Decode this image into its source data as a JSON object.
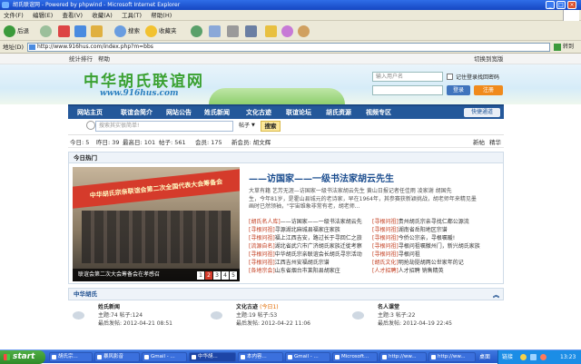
{
  "window": {
    "title": "胡氏联谊网 - Powered by phpwind - Microsoft Internet Explorer"
  },
  "menu": [
    "文件(F)",
    "编辑(E)",
    "查看(V)",
    "收藏(A)",
    "工具(T)",
    "帮助(H)"
  ],
  "toolbar": {
    "back": "后退",
    "search": "搜索",
    "favorites": "收藏夹"
  },
  "address": {
    "label": "地址(D)",
    "url": "http://www.916hus.com/index.php?m=bbs",
    "go": "转到"
  },
  "site": {
    "topbar_left": [
      "统计排行",
      "帮助"
    ],
    "topbar_right": "切换到宽版",
    "logo_title": "中华胡氏联谊网",
    "logo_url": "www.916hus.com",
    "login": {
      "user_placeholder": "输入用户名",
      "remember": "记住登录",
      "forgot": "找回密码",
      "login_btn": "登录",
      "register_btn": "注册"
    },
    "nav": [
      "网站主页",
      "联谊会简介",
      "网站公告",
      "姓氏新闻",
      "文化古迹",
      "联谊论坛",
      "胡氏资源",
      "视频专区"
    ],
    "quick": "快捷通道",
    "search": {
      "placeholder": "搜索其实很简单!",
      "scope": "帖子",
      "button": "搜索"
    },
    "stats": {
      "today": "今日: 5",
      "yesterday": "昨日: 39",
      "max": "最高日: 101",
      "posts": "帖子: 561",
      "members": "会员: 175",
      "new_member": "新会员: 胡文辉"
    },
    "stats_right": [
      "新帖",
      "精华"
    ],
    "hot_title": "今日热门",
    "banner_text": "中华胡氏宗亲联谊会第二次全国代表大会筹备会",
    "slide_caption": "联谊会第二次大会筹备会在孝感召",
    "slide_nums": [
      "1",
      "2",
      "3",
      "4",
      "5"
    ],
    "headline": "——访国家——一级书法家胡云先生",
    "summary": [
      "大草有籍    艺芳无涯—访国家一级书法家胡云先生  黄山日报记者任佳雨  凌家谢    胡国先",
      "生，今年81岁，是霍山县城元的老诗家，早在1964年，其参赛获新颖挑战，胡老师年来精见墨",
      "画时已然领袖，\"宇宙维象非常有老，胡老师..."
    ],
    "news_left": [
      {
        "tag": "[胡氏名人库]",
        "title": "——访国家——一级书法家胡云先"
      },
      {
        "tag": "[寻根问祖]",
        "title": "寻源湖北麻城县福家庄家族"
      },
      {
        "tag": "[寻根问祖]",
        "title": "福上江西吉安，路过长于寻回仁之旅"
      },
      {
        "tag": "[流源自名]",
        "title": "湖北省武穴市广济胡氏家族迁徙考察"
      },
      {
        "tag": "[寻根问祖]",
        "title": "中华胡氏宗亲联谊会长胡氏寻宗活动"
      },
      {
        "tag": "[寻根问祖]",
        "title": "江西吉州安福胡氏宗谱"
      },
      {
        "tag": "[各地宗会]",
        "title": "山东省烟台市莱阳县胡家庄"
      }
    ],
    "news_right": [
      {
        "tag": "[寻根问祖]",
        "title": "贵州胡氏宗亲寻找仁都公源流"
      },
      {
        "tag": "[寻根问祖]",
        "title": "湖南省岳阳地区宗谱"
      },
      {
        "tag": "[寻根问祖]",
        "title": "今侨公宗亲，寻根嘱暖!"
      },
      {
        "tag": "[寻根问祖]",
        "title": "寻根问祖嘱徽州门，新兴胡氏家族"
      },
      {
        "tag": "[寻根问祖]",
        "title": "寻根问祖"
      },
      {
        "tag": "[胡氏文化]",
        "title": "明抢劫挺胡两公世家年的记"
      },
      {
        "tag": "[人才招聘]",
        "title": "人才招聘 销售精英"
      }
    ],
    "zone": "中华胡氏",
    "forums": [
      {
        "name": "姓氏新闻",
        "today": "",
        "stats": "主题:74  帖子:124",
        "last": "最后发帖: 2012-04-21 08:51"
      },
      {
        "name": "文化古迹",
        "today": "(今日1)",
        "stats": "主题:19  帖子:53",
        "last": "最后发帖: 2012-04-22 11:06"
      },
      {
        "name": "名人课堂",
        "today": "",
        "stats": "主题:3  帖子:22",
        "last": "最后发帖: 2012-04-19 22:45"
      }
    ]
  },
  "taskbar": {
    "start": "start",
    "tasks": [
      "胡氏宗...",
      "暴风影音",
      "Gmail - ...",
      "中华胡...",
      "本内容...",
      "Gmail - ...",
      "Microsoft...",
      "http://ww...",
      "http://ww..."
    ],
    "tray_left": "桌面",
    "tray_mid": "链接",
    "clock": "13:23"
  },
  "colors": {
    "nav": "#24589a",
    "logo_green": "#3aa131",
    "accent_red": "#d53b2b",
    "taskbar": "#2456c8"
  }
}
